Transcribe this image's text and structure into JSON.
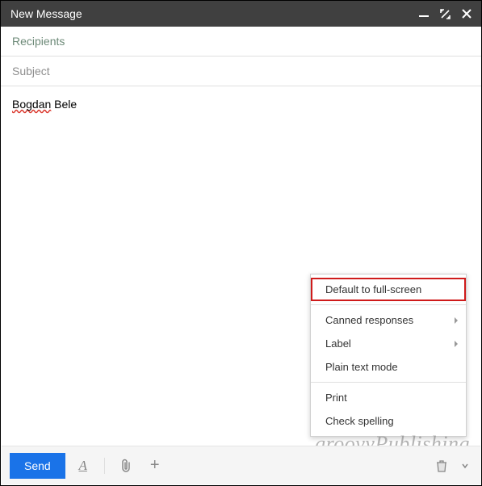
{
  "titlebar": {
    "title": "New Message"
  },
  "fields": {
    "recipients_placeholder": "Recipients",
    "subject_placeholder": "Subject"
  },
  "body": {
    "word1": "Bogdan",
    "word2": "Bele"
  },
  "menu": {
    "default_fullscreen": "Default to full-screen",
    "canned": "Canned responses",
    "label": "Label",
    "plain": "Plain text mode",
    "print": "Print",
    "check_spell": "Check spelling"
  },
  "bottombar": {
    "send": "Send",
    "format_glyph": "A",
    "plus_glyph": "+"
  },
  "watermark": "groovyPublishing"
}
